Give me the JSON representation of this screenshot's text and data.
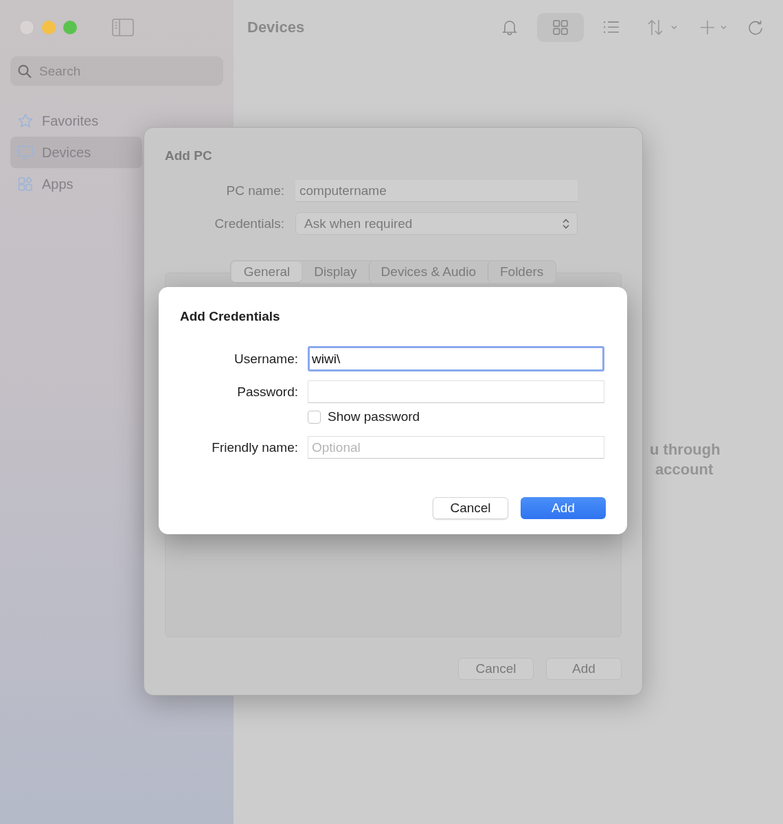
{
  "window": {
    "title": "Devices"
  },
  "sidebar": {
    "search": {
      "placeholder": "Search"
    },
    "items": [
      {
        "label": "Favorites",
        "kind": "star",
        "selected": false
      },
      {
        "label": "Devices",
        "kind": "monitor",
        "selected": true
      },
      {
        "label": "Apps",
        "kind": "apps",
        "selected": false
      }
    ]
  },
  "toolbar": {
    "view_modes": [
      {
        "kind": "grid",
        "selected": true
      },
      {
        "kind": "list",
        "selected": false
      }
    ]
  },
  "background_message": [
    "u through",
    "account"
  ],
  "add_pc_dialog": {
    "title": "Add PC",
    "fields": [
      {
        "label": "PC name:",
        "value": "computername",
        "kind": "text"
      },
      {
        "label": "Credentials:",
        "value": "Ask when required",
        "kind": "popup"
      }
    ],
    "tabs": [
      {
        "label": "General",
        "selected": true
      },
      {
        "label": "Display",
        "selected": false
      },
      {
        "label": "Devices & Audio",
        "selected": false
      },
      {
        "label": "Folders",
        "selected": false
      }
    ],
    "buttons": [
      "Cancel",
      "Add"
    ]
  },
  "add_credentials_dialog": {
    "title": "Add Credentials",
    "fields": [
      {
        "label": "Username:",
        "value": "wiwi\\",
        "focused": true
      },
      {
        "label": "Password:",
        "focused": false
      }
    ],
    "show_password": {
      "label": "Show password",
      "checked": false
    },
    "friendly_name": {
      "label": "Friendly name:",
      "placeholder": "Optional",
      "focused": false
    },
    "buttons": [
      {
        "label": "Cancel",
        "kind": "secondary"
      },
      {
        "label": "Add",
        "kind": "primary"
      }
    ]
  }
}
